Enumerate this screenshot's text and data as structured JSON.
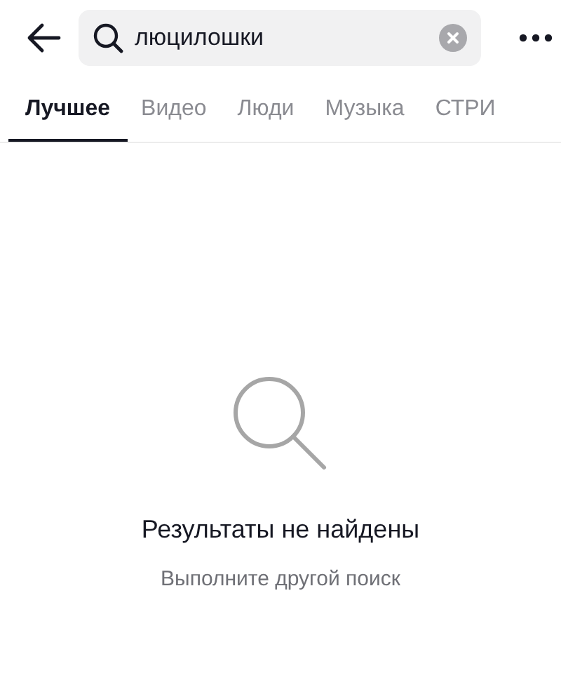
{
  "search": {
    "value": "люцилошки"
  },
  "tabs": [
    {
      "label": "Лучшее",
      "selected": true
    },
    {
      "label": "Видео",
      "selected": false
    },
    {
      "label": "Люди",
      "selected": false
    },
    {
      "label": "Музыка",
      "selected": false
    },
    {
      "label": "СТРИ",
      "selected": false
    }
  ],
  "empty_state": {
    "title": "Результаты не найдены",
    "subtitle": "Выполните другой поиск"
  }
}
